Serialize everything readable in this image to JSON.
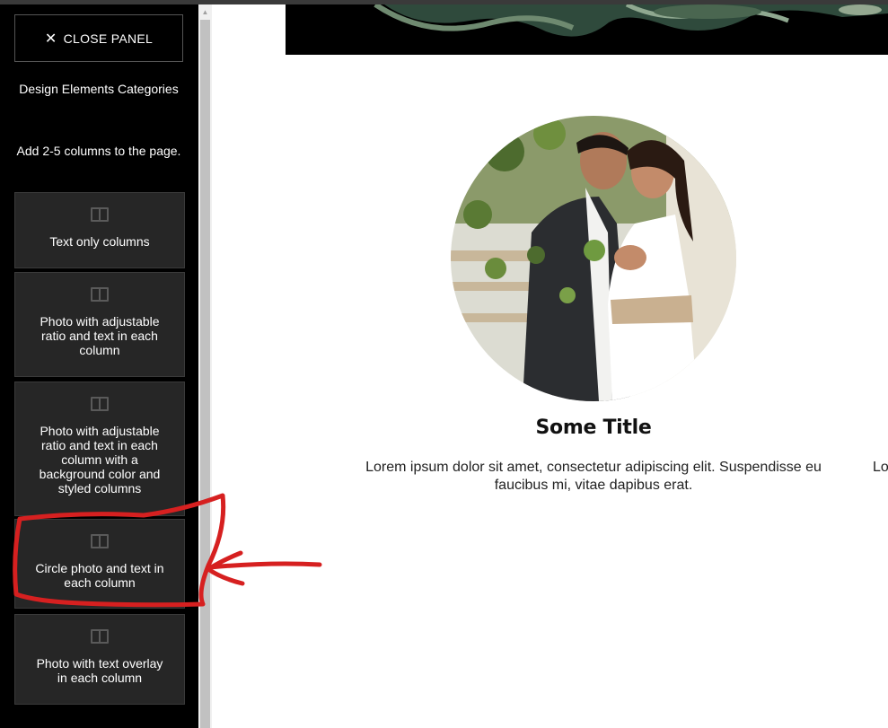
{
  "sidebar": {
    "close_label": "CLOSE PANEL",
    "heading": "Design Elements Categories",
    "subheading": "Add 2-5 columns to the page.",
    "cards": [
      {
        "label": "Text only columns",
        "icon": "columns-icon"
      },
      {
        "label": "Photo with adjustable ratio and text in each column",
        "icon": "columns-icon"
      },
      {
        "label": "Photo with adjustable ratio and text in each column with a background color and styled columns",
        "icon": "columns-icon"
      },
      {
        "label": "Circle photo and text in each column",
        "icon": "columns-icon"
      },
      {
        "label": "Photo with text overlay in each column",
        "icon": "columns-icon"
      }
    ]
  },
  "main": {
    "column_title": "Some Title",
    "column_text": "Lorem ipsum dolor sit amet, consectetur adipiscing elit. Suspendisse eu faucibus mi, vitae dapibus erat.",
    "next_column_text": "Lo"
  },
  "colors": {
    "sidebar_bg": "#000000",
    "card_bg": "#262626",
    "annotation": "#d62020"
  }
}
